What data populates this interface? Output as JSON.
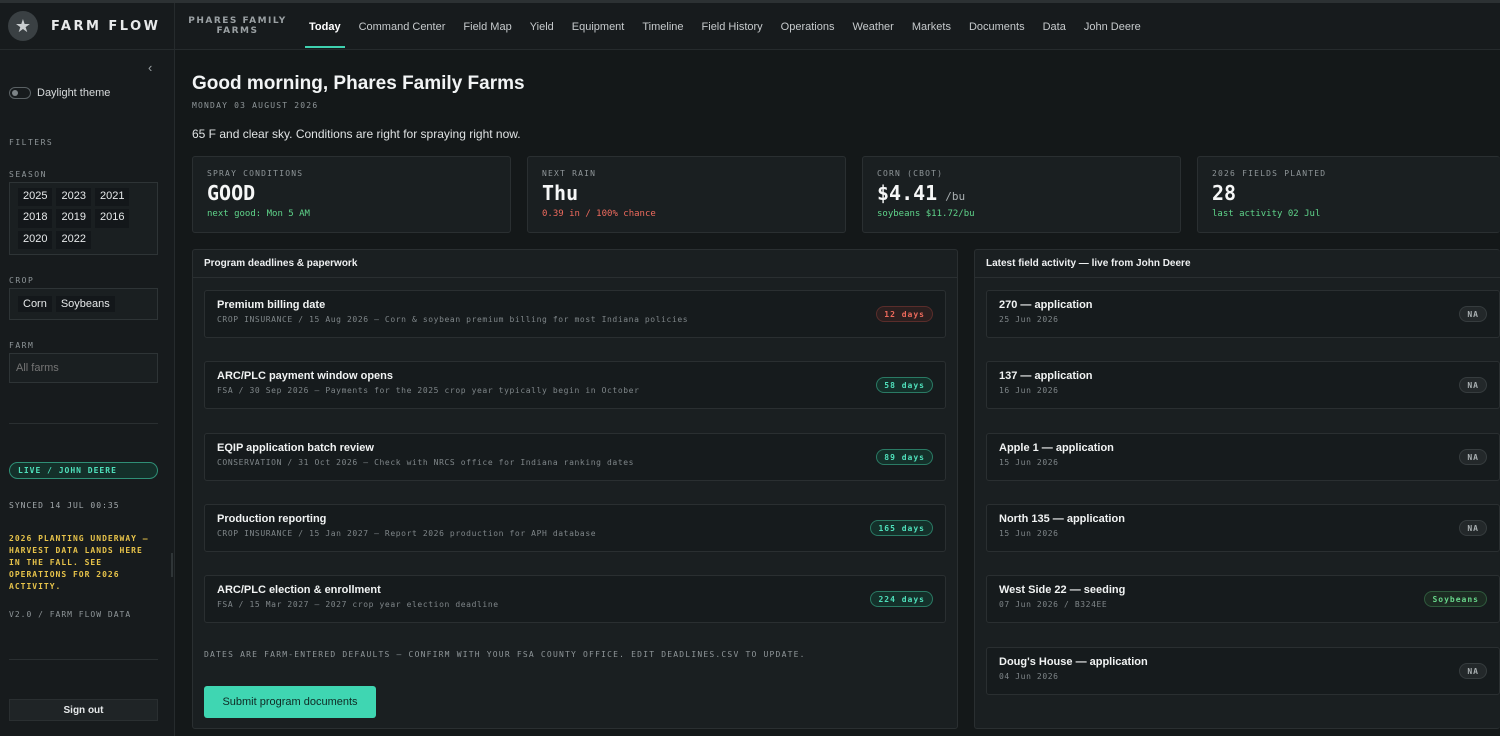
{
  "app": {
    "name": "FARM FLOW",
    "farm_label": "PHARES FAMILY FARMS",
    "logo_icon": "★"
  },
  "nav": [
    {
      "label": "Today",
      "active": true
    },
    {
      "label": "Command Center"
    },
    {
      "label": "Field Map"
    },
    {
      "label": "Yield"
    },
    {
      "label": "Equipment"
    },
    {
      "label": "Timeline"
    },
    {
      "label": "Field History"
    },
    {
      "label": "Operations"
    },
    {
      "label": "Weather"
    },
    {
      "label": "Markets"
    },
    {
      "label": "Documents"
    },
    {
      "label": "Data"
    },
    {
      "label": "John Deere"
    }
  ],
  "sidebar": {
    "collapse_icon": "‹",
    "theme_label": "Daylight theme",
    "filters_heading": "FILTERS",
    "season_heading": "SEASON",
    "seasons": [
      "2025",
      "2023",
      "2021",
      "2018",
      "2019",
      "2016",
      "2020",
      "2022"
    ],
    "crop_heading": "CROP",
    "crops": [
      "Corn",
      "Soybeans"
    ],
    "farm_heading": "FARM",
    "farm_placeholder": "All farms",
    "live_badge": "LIVE / JOHN DEERE",
    "synced": "SYNCED 14 JUL 00:35",
    "planting_note": "2026 PLANTING UNDERWAY — HARVEST DATA LANDS HERE IN THE FALL. SEE OPERATIONS FOR 2026 ACTIVITY.",
    "version": "V2.0 / FARM FLOW DATA",
    "signout": "Sign out"
  },
  "main": {
    "greeting": "Good morning, Phares Family Farms",
    "date": "MONDAY 03 AUGUST 2026",
    "sky": "65 F and clear sky. Conditions are right for spraying right now."
  },
  "stats": {
    "spray": {
      "label": "SPRAY CONDITIONS",
      "value": "GOOD",
      "sub": "next good: Mon 5 AM"
    },
    "rain": {
      "label": "NEXT RAIN",
      "value": "Thu",
      "sub": "0.39 in / 100% chance"
    },
    "corn": {
      "label": "CORN (CBOT)",
      "value": "$4.41",
      "unit": "/bu",
      "sub": "soybeans $11.72/bu"
    },
    "fields": {
      "label": "2026 FIELDS PLANTED",
      "value": "28",
      "sub": "last activity 02 Jul"
    }
  },
  "deadlines": {
    "title": "Program deadlines & paperwork",
    "items": [
      {
        "title": "Premium billing date",
        "sub": "CROP INSURANCE / 15 Aug 2026 — Corn & soybean premium billing for most Indiana policies",
        "badge": "12 days",
        "status": "red"
      },
      {
        "title": "ARC/PLC payment window opens",
        "sub": "FSA / 30 Sep 2026 — Payments for the 2025 crop year typically begin in October",
        "badge": "58 days",
        "status": "green"
      },
      {
        "title": "EQIP application batch review",
        "sub": "CONSERVATION / 31 Oct 2026 — Check with NRCS office for Indiana ranking dates",
        "badge": "89 days",
        "status": "green"
      },
      {
        "title": "Production reporting",
        "sub": "CROP INSURANCE / 15 Jan 2027 — Report 2026 production for APH database",
        "badge": "165 days",
        "status": "green"
      },
      {
        "title": "ARC/PLC election & enrollment",
        "sub": "FSA / 15 Mar 2027 — 2027 crop year election deadline",
        "badge": "224 days",
        "status": "green"
      }
    ],
    "footnote": "DATES ARE FARM-ENTERED DEFAULTS — CONFIRM WITH YOUR FSA COUNTY OFFICE. EDIT DEADLINES.CSV TO UPDATE.",
    "submit": "Submit program documents"
  },
  "activity": {
    "title": "Latest field activity — live from John Deere",
    "items": [
      {
        "title": "270 — application",
        "sub": "25 Jun 2026",
        "badge": "NA"
      },
      {
        "title": "137 — application",
        "sub": "16 Jun 2026",
        "badge": "NA"
      },
      {
        "title": "Apple 1 — application",
        "sub": "15 Jun 2026",
        "badge": "NA"
      },
      {
        "title": "North 135 — application",
        "sub": "15 Jun 2026",
        "badge": "NA"
      },
      {
        "title": "West Side 22 — seeding",
        "sub": "07 Jun 2026 / B324EE",
        "badge": "Soybeans"
      },
      {
        "title": "Doug's House — application",
        "sub": "04 Jun 2026",
        "badge": "NA"
      }
    ]
  },
  "colors": {
    "accent": "#3fd1b0",
    "warning": "#e7c34a",
    "danger": "#ee6a5c",
    "positive": "#5fd48a"
  }
}
